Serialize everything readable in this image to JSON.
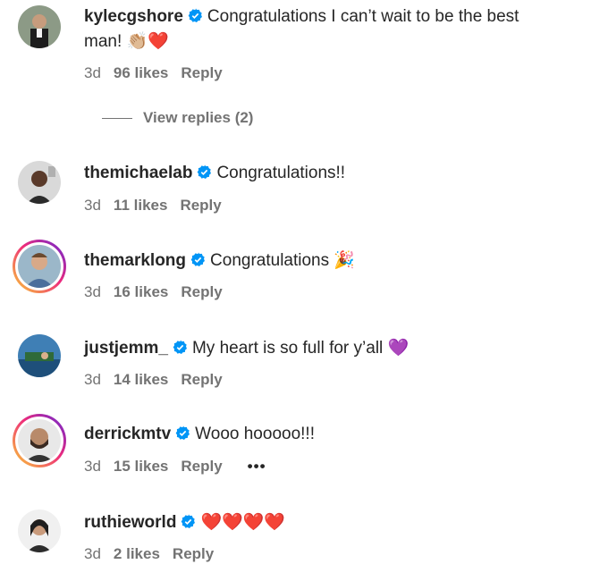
{
  "comments": [
    {
      "username": "kylecgshore",
      "text_line1": "Congratulations I can’t wait to be the best",
      "text_line2": "man! ",
      "emoji": "👏🏼❤️",
      "time": "3d",
      "likes": "96 likes",
      "reply": "Reply"
    },
    {
      "username": "themichaelab",
      "text": "Congratulations!!",
      "time": "3d",
      "likes": "11 likes",
      "reply": "Reply"
    },
    {
      "username": "themarklong",
      "text": "Congratulations ",
      "emoji": "🎉",
      "time": "3d",
      "likes": "16 likes",
      "reply": "Reply"
    },
    {
      "username": "justjemm_",
      "text": "My heart is so full for y’all ",
      "emoji": "💜",
      "time": "3d",
      "likes": "14 likes",
      "reply": "Reply"
    },
    {
      "username": "derrickmtv",
      "text": "Wooo hooooo!!!",
      "time": "3d",
      "likes": "15 likes",
      "reply": "Reply",
      "more": "•••"
    },
    {
      "username": "ruthieworld",
      "emoji": "❤️❤️❤️❤️",
      "time": "3d",
      "likes": "2 likes",
      "reply": "Reply"
    }
  ],
  "view_replies": "View replies (2)",
  "icons": {
    "verified": "verified-badge-icon",
    "more": "more-options-icon"
  },
  "colors": {
    "verified": "#0095f6",
    "secondary_text": "#737373",
    "primary_text": "#262626"
  }
}
